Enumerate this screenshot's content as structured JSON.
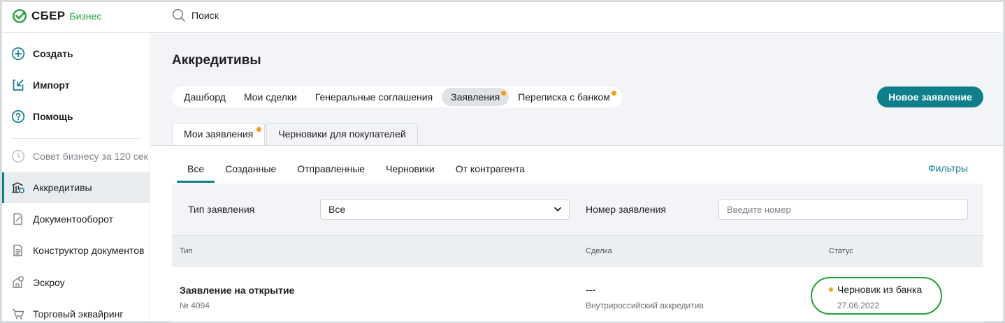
{
  "brand": {
    "name": "СБЕР",
    "suffix": "Бизнес",
    "color": "#21a038"
  },
  "search": {
    "label": "Поиск",
    "icon": "search-icon"
  },
  "sidebar": {
    "items": [
      {
        "label": "Создать",
        "icon": "plus-circle-icon"
      },
      {
        "label": "Импорт",
        "icon": "import-icon"
      },
      {
        "label": "Помощь",
        "icon": "help-icon"
      },
      {
        "label": "Совет бизнесу за 120 сек",
        "icon": "clock-icon"
      },
      {
        "label": "Аккредитивы",
        "icon": "bank-icon"
      },
      {
        "label": "Документооборот",
        "icon": "document-edit-icon"
      },
      {
        "label": "Конструктор документов",
        "icon": "document-constructor-icon"
      },
      {
        "label": "Эскроу",
        "icon": "escrow-icon"
      },
      {
        "label": "Торговый эквайринг",
        "icon": "cart-icon"
      }
    ]
  },
  "main": {
    "title": "Аккредитивы",
    "tabs": [
      {
        "label": "Дашборд"
      },
      {
        "label": "Мои сделки"
      },
      {
        "label": "Генеральные соглашения"
      },
      {
        "label": "Заявления",
        "active": true,
        "has_dot": true
      },
      {
        "label": "Переписка с банком",
        "has_dot": true
      }
    ],
    "new_button_label": "Новое заявление",
    "subtabs": [
      {
        "label": "Мои заявления",
        "active": true,
        "has_dot": true
      },
      {
        "label": "Черновики для покупателей"
      }
    ],
    "filter_tabs": [
      {
        "label": "Все",
        "active": true
      },
      {
        "label": "Созданные"
      },
      {
        "label": "Отправленные"
      },
      {
        "label": "Черновики"
      },
      {
        "label": "От контрагента"
      }
    ],
    "filters_link": "Фильтры",
    "filters": {
      "type_label": "Тип заявления",
      "type_value": "Все",
      "number_label": "Номер заявления",
      "number_placeholder": "Введите номер"
    },
    "table": {
      "headers": {
        "type": "Тип",
        "deal": "Сделка",
        "status": "Статус"
      },
      "rows": [
        {
          "title": "Заявление на открытие",
          "number": "№ 4094",
          "deal": "---",
          "deal_type": "Внутрироссийский аккредитив",
          "status": "Черновик из банка",
          "date": "27.06.2022"
        }
      ]
    }
  },
  "colors": {
    "accent": "#107f8c",
    "status_dot": "#f59d0e",
    "highlight": "#21a038"
  }
}
